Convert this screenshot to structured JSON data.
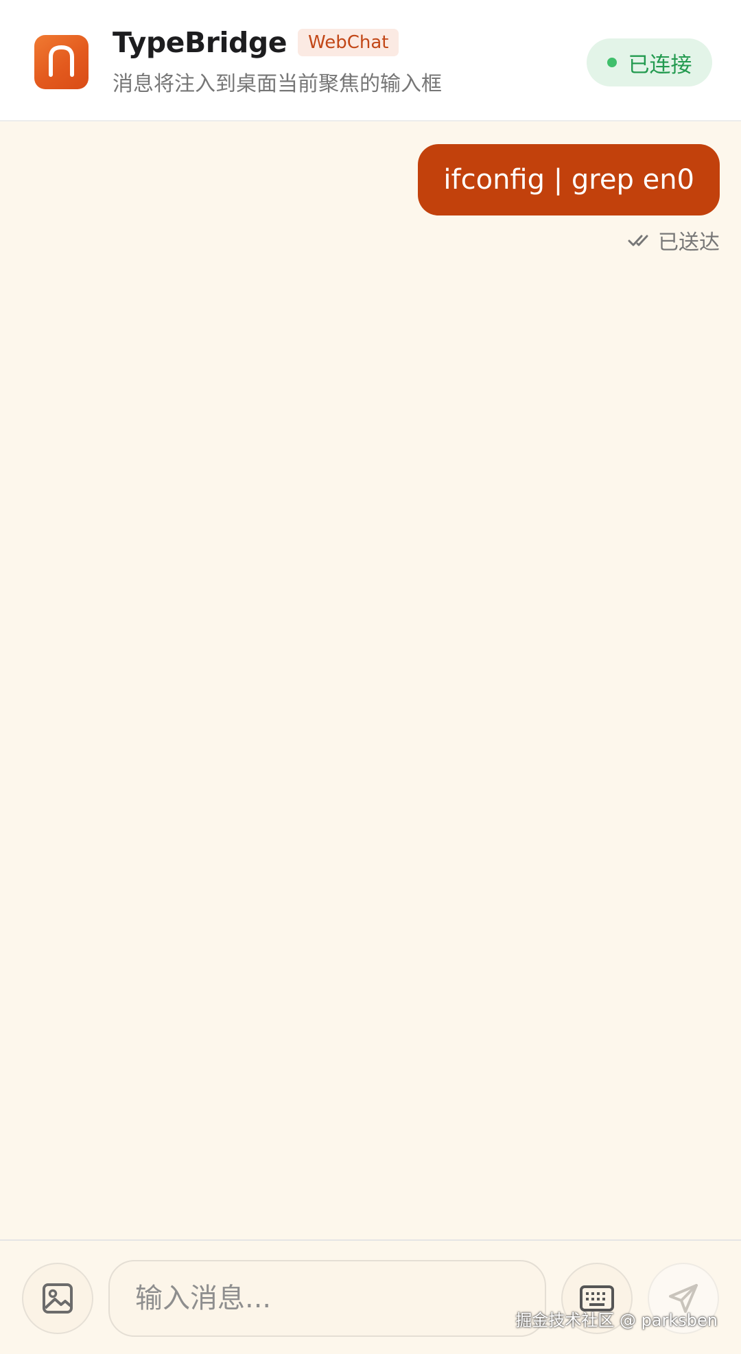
{
  "header": {
    "title": "TypeBridge",
    "badge": "WebChat",
    "subtitle": "消息将注入到桌面当前聚焦的输入框",
    "status": {
      "label": "已连接",
      "color": "#3fbf6b"
    },
    "icon": "app-logo-icon"
  },
  "chat": {
    "messages": [
      {
        "text": "ifconfig | grep en0",
        "direction": "outgoing",
        "status": "已送达",
        "status_icon": "double-check-icon"
      }
    ]
  },
  "composer": {
    "placeholder": "输入消息...",
    "value": "",
    "buttons": {
      "image": "image-icon",
      "keyboard": "keyboard-icon",
      "send": "send-icon"
    }
  },
  "watermark": "掘金技术社区 @ parksben",
  "colors": {
    "accent": "#c2410c",
    "background": "#fdf7ec",
    "status_bg": "#e3f4e8"
  }
}
